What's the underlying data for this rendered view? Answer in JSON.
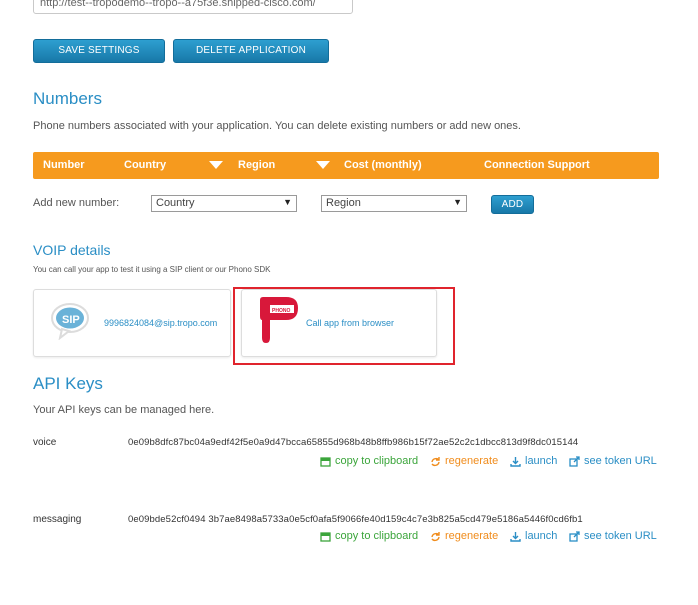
{
  "app_url": "http://test--tropodemo--tropo--a75f3e.shipped-cisco.com/",
  "buttons": {
    "save": "SAVE SETTINGS",
    "delete": "DELETE APPLICATION"
  },
  "numbers": {
    "title": "Numbers",
    "description": "Phone numbers associated with your application. You can delete existing numbers or add new ones.",
    "columns": [
      "Number",
      "Country",
      "Region",
      "Cost (monthly)",
      "Connection Support"
    ],
    "add_label": "Add new number:",
    "country_select": "Country",
    "region_select": "Region",
    "add_button": "ADD"
  },
  "voip": {
    "title": "VOIP details",
    "description": "You can call your app to test it using a SIP client or our Phono SDK",
    "sip_badge": "SIP",
    "sip_address": "9996824084@sip.tropo.com",
    "phono_badge": "PHONO",
    "phono_link": "Call app from browser"
  },
  "api_keys": {
    "title": "API Keys",
    "description": "Your API keys can be managed here.",
    "keys": [
      {
        "name": "voice",
        "value": "0e09b8dfc87bc04a9edf42f5e0a9d47bcca65855d968b48b8ffb986b15f72ae52c2c1dbcc813d9f8dc015144"
      },
      {
        "name": "messaging",
        "value": "0e09bde52cf0494 3b7ae8498a5733a0e5cf0afa5f9066fe40d159c4c7e3b825a5cd479e5186a5446f0cd6fb1"
      }
    ],
    "actions": {
      "copy": "copy to clipboard",
      "regenerate": "regenerate",
      "launch": "launch",
      "token_url": "see token URL"
    }
  },
  "colors": {
    "accent_blue": "#2a8ec5",
    "header_orange": "#f69a1e",
    "highlight_red": "#e0242d",
    "phono_red": "#d8183a",
    "copy_green": "#3ba53b"
  }
}
